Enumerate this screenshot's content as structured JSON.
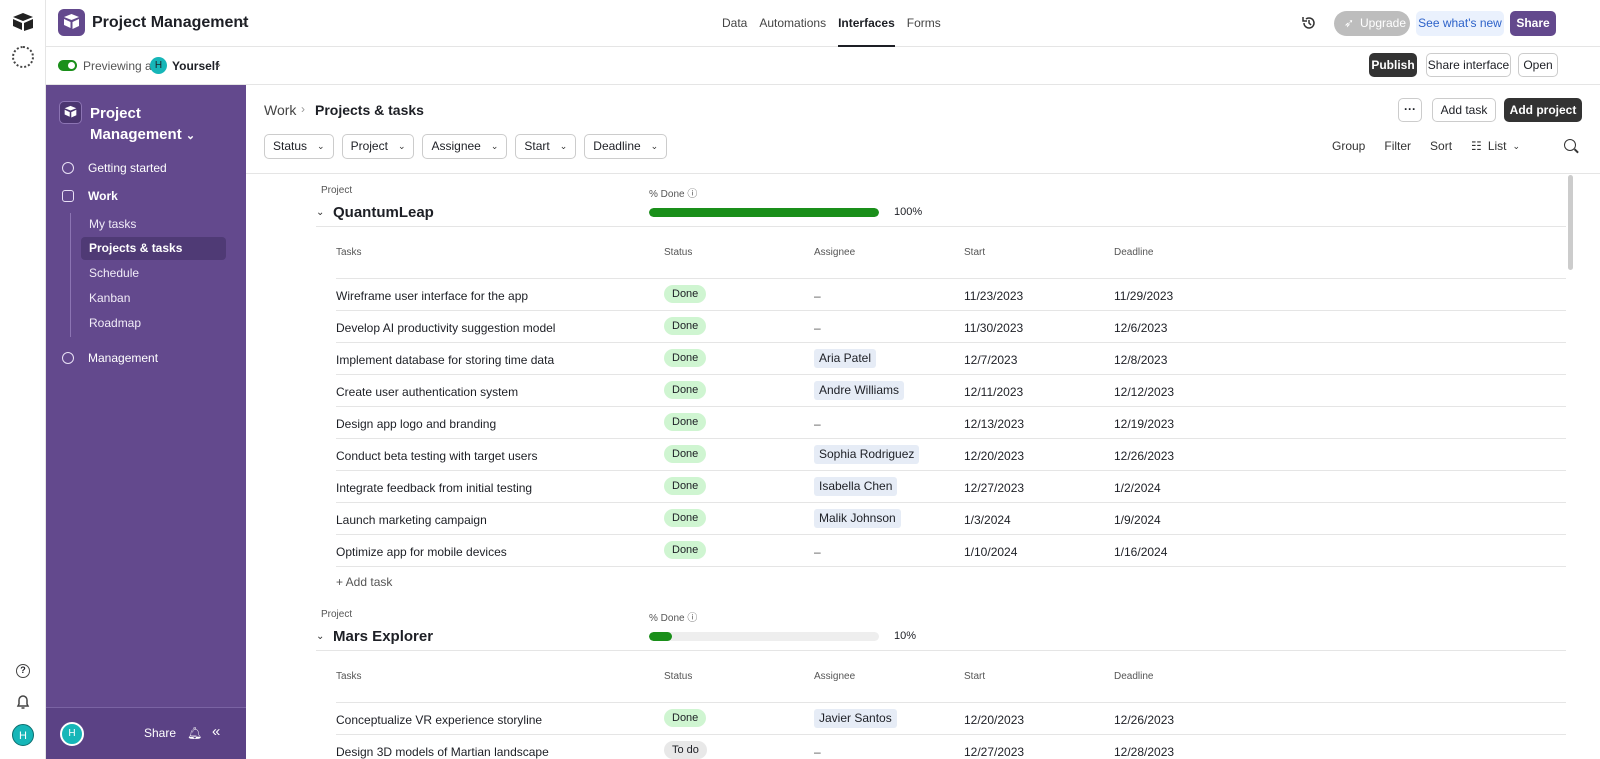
{
  "app": {
    "title": "Project Management"
  },
  "nav": {
    "tabs": [
      "Data",
      "Automations",
      "Interfaces",
      "Forms"
    ],
    "active": "Interfaces"
  },
  "top_actions": {
    "upgrade": "Upgrade",
    "whats_new": "See what's new",
    "share": "Share"
  },
  "preview": {
    "label": "Previewing as",
    "avatar_initial": "H",
    "user": "Yourself"
  },
  "preview_actions": {
    "publish": "Publish",
    "share_interface": "Share interface",
    "open": "Open"
  },
  "rail": {
    "avatar_initial": "H"
  },
  "sidebar": {
    "title": "Project Management",
    "items": [
      {
        "label": "Getting started",
        "icon": "info-icon"
      },
      {
        "label": "Work",
        "icon": "briefcase-icon"
      },
      {
        "label": "Management",
        "icon": "gauge-icon"
      }
    ],
    "sub_items": [
      "My tasks",
      "Projects & tasks",
      "Schedule",
      "Kanban",
      "Roadmap"
    ],
    "active_sub": "Projects & tasks",
    "bottom": {
      "avatar_initial": "H",
      "share": "Share"
    }
  },
  "breadcrumb": {
    "parent": "Work",
    "sep": "›",
    "current": "Projects & tasks"
  },
  "header_actions": {
    "more": "···",
    "add_task": "Add task",
    "add_project": "Add project"
  },
  "filters": [
    "Status",
    "Project",
    "Assignee",
    "Start",
    "Deadline"
  ],
  "tools": {
    "group": "Group",
    "filter": "Filter",
    "sort": "Sort",
    "list": "List"
  },
  "table_labels": {
    "project": "Project",
    "pct_done": "% Done ⓘ",
    "tasks": "Tasks",
    "status": "Status",
    "assignee": "Assignee",
    "start": "Start",
    "deadline": "Deadline",
    "add_task": "+ Add task"
  },
  "projects": [
    {
      "name": "QuantumLeap",
      "pct": 100,
      "pct_label": "100%",
      "tasks": [
        {
          "task": "Wireframe user interface for the app",
          "status": "Done",
          "assignee": "–",
          "start": "11/23/2023",
          "deadline": "11/29/2023"
        },
        {
          "task": "Develop AI productivity suggestion model",
          "status": "Done",
          "assignee": "–",
          "start": "11/30/2023",
          "deadline": "12/6/2023"
        },
        {
          "task": "Implement database for storing time data",
          "status": "Done",
          "assignee": "Aria Patel",
          "start": "12/7/2023",
          "deadline": "12/8/2023"
        },
        {
          "task": "Create user authentication system",
          "status": "Done",
          "assignee": "Andre Williams",
          "start": "12/11/2023",
          "deadline": "12/12/2023"
        },
        {
          "task": "Design app logo and branding",
          "status": "Done",
          "assignee": "–",
          "start": "12/13/2023",
          "deadline": "12/19/2023"
        },
        {
          "task": "Conduct beta testing with target users",
          "status": "Done",
          "assignee": "Sophia Rodriguez",
          "start": "12/20/2023",
          "deadline": "12/26/2023"
        },
        {
          "task": "Integrate feedback from initial testing",
          "status": "Done",
          "assignee": "Isabella Chen",
          "start": "12/27/2023",
          "deadline": "1/2/2024"
        },
        {
          "task": "Launch marketing campaign",
          "status": "Done",
          "assignee": "Malik Johnson",
          "start": "1/3/2024",
          "deadline": "1/9/2024"
        },
        {
          "task": "Optimize app for mobile devices",
          "status": "Done",
          "assignee": "–",
          "start": "1/10/2024",
          "deadline": "1/16/2024"
        }
      ]
    },
    {
      "name": "Mars Explorer",
      "pct": 10,
      "pct_label": "10%",
      "tasks": [
        {
          "task": "Conceptualize VR experience storyline",
          "status": "Done",
          "assignee": "Javier Santos",
          "start": "12/20/2023",
          "deadline": "12/26/2023"
        },
        {
          "task": "Design 3D models of Martian landscape",
          "status": "To do",
          "assignee": "–",
          "start": "12/27/2023",
          "deadline": "12/28/2023"
        }
      ]
    }
  ],
  "colors": {
    "sidebar": "#63498d",
    "done_pill": "#cff5d1",
    "progress": "#1a8f1a"
  }
}
